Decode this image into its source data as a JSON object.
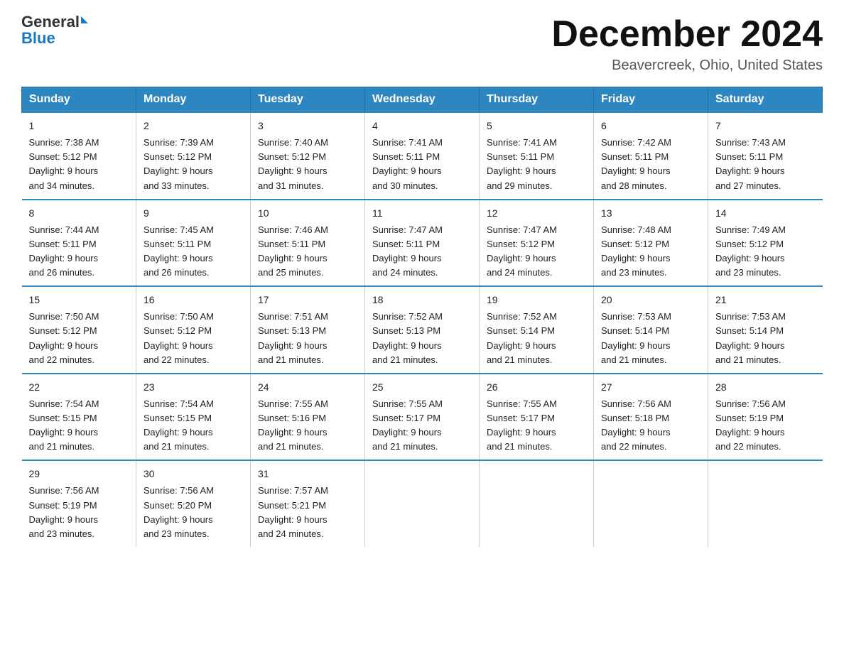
{
  "logo": {
    "text1": "General",
    "text2": "Blue"
  },
  "header": {
    "title": "December 2024",
    "subtitle": "Beavercreek, Ohio, United States"
  },
  "days_of_week": [
    "Sunday",
    "Monday",
    "Tuesday",
    "Wednesday",
    "Thursday",
    "Friday",
    "Saturday"
  ],
  "weeks": [
    [
      {
        "day": "1",
        "sunrise": "7:38 AM",
        "sunset": "5:12 PM",
        "daylight": "9 hours and 34 minutes."
      },
      {
        "day": "2",
        "sunrise": "7:39 AM",
        "sunset": "5:12 PM",
        "daylight": "9 hours and 33 minutes."
      },
      {
        "day": "3",
        "sunrise": "7:40 AM",
        "sunset": "5:12 PM",
        "daylight": "9 hours and 31 minutes."
      },
      {
        "day": "4",
        "sunrise": "7:41 AM",
        "sunset": "5:11 PM",
        "daylight": "9 hours and 30 minutes."
      },
      {
        "day": "5",
        "sunrise": "7:41 AM",
        "sunset": "5:11 PM",
        "daylight": "9 hours and 29 minutes."
      },
      {
        "day": "6",
        "sunrise": "7:42 AM",
        "sunset": "5:11 PM",
        "daylight": "9 hours and 28 minutes."
      },
      {
        "day": "7",
        "sunrise": "7:43 AM",
        "sunset": "5:11 PM",
        "daylight": "9 hours and 27 minutes."
      }
    ],
    [
      {
        "day": "8",
        "sunrise": "7:44 AM",
        "sunset": "5:11 PM",
        "daylight": "9 hours and 26 minutes."
      },
      {
        "day": "9",
        "sunrise": "7:45 AM",
        "sunset": "5:11 PM",
        "daylight": "9 hours and 26 minutes."
      },
      {
        "day": "10",
        "sunrise": "7:46 AM",
        "sunset": "5:11 PM",
        "daylight": "9 hours and 25 minutes."
      },
      {
        "day": "11",
        "sunrise": "7:47 AM",
        "sunset": "5:11 PM",
        "daylight": "9 hours and 24 minutes."
      },
      {
        "day": "12",
        "sunrise": "7:47 AM",
        "sunset": "5:12 PM",
        "daylight": "9 hours and 24 minutes."
      },
      {
        "day": "13",
        "sunrise": "7:48 AM",
        "sunset": "5:12 PM",
        "daylight": "9 hours and 23 minutes."
      },
      {
        "day": "14",
        "sunrise": "7:49 AM",
        "sunset": "5:12 PM",
        "daylight": "9 hours and 23 minutes."
      }
    ],
    [
      {
        "day": "15",
        "sunrise": "7:50 AM",
        "sunset": "5:12 PM",
        "daylight": "9 hours and 22 minutes."
      },
      {
        "day": "16",
        "sunrise": "7:50 AM",
        "sunset": "5:12 PM",
        "daylight": "9 hours and 22 minutes."
      },
      {
        "day": "17",
        "sunrise": "7:51 AM",
        "sunset": "5:13 PM",
        "daylight": "9 hours and 21 minutes."
      },
      {
        "day": "18",
        "sunrise": "7:52 AM",
        "sunset": "5:13 PM",
        "daylight": "9 hours and 21 minutes."
      },
      {
        "day": "19",
        "sunrise": "7:52 AM",
        "sunset": "5:14 PM",
        "daylight": "9 hours and 21 minutes."
      },
      {
        "day": "20",
        "sunrise": "7:53 AM",
        "sunset": "5:14 PM",
        "daylight": "9 hours and 21 minutes."
      },
      {
        "day": "21",
        "sunrise": "7:53 AM",
        "sunset": "5:14 PM",
        "daylight": "9 hours and 21 minutes."
      }
    ],
    [
      {
        "day": "22",
        "sunrise": "7:54 AM",
        "sunset": "5:15 PM",
        "daylight": "9 hours and 21 minutes."
      },
      {
        "day": "23",
        "sunrise": "7:54 AM",
        "sunset": "5:15 PM",
        "daylight": "9 hours and 21 minutes."
      },
      {
        "day": "24",
        "sunrise": "7:55 AM",
        "sunset": "5:16 PM",
        "daylight": "9 hours and 21 minutes."
      },
      {
        "day": "25",
        "sunrise": "7:55 AM",
        "sunset": "5:17 PM",
        "daylight": "9 hours and 21 minutes."
      },
      {
        "day": "26",
        "sunrise": "7:55 AM",
        "sunset": "5:17 PM",
        "daylight": "9 hours and 21 minutes."
      },
      {
        "day": "27",
        "sunrise": "7:56 AM",
        "sunset": "5:18 PM",
        "daylight": "9 hours and 22 minutes."
      },
      {
        "day": "28",
        "sunrise": "7:56 AM",
        "sunset": "5:19 PM",
        "daylight": "9 hours and 22 minutes."
      }
    ],
    [
      {
        "day": "29",
        "sunrise": "7:56 AM",
        "sunset": "5:19 PM",
        "daylight": "9 hours and 23 minutes."
      },
      {
        "day": "30",
        "sunrise": "7:56 AM",
        "sunset": "5:20 PM",
        "daylight": "9 hours and 23 minutes."
      },
      {
        "day": "31",
        "sunrise": "7:57 AM",
        "sunset": "5:21 PM",
        "daylight": "9 hours and 24 minutes."
      },
      {
        "day": "",
        "sunrise": "",
        "sunset": "",
        "daylight": ""
      },
      {
        "day": "",
        "sunrise": "",
        "sunset": "",
        "daylight": ""
      },
      {
        "day": "",
        "sunrise": "",
        "sunset": "",
        "daylight": ""
      },
      {
        "day": "",
        "sunrise": "",
        "sunset": "",
        "daylight": ""
      }
    ]
  ]
}
